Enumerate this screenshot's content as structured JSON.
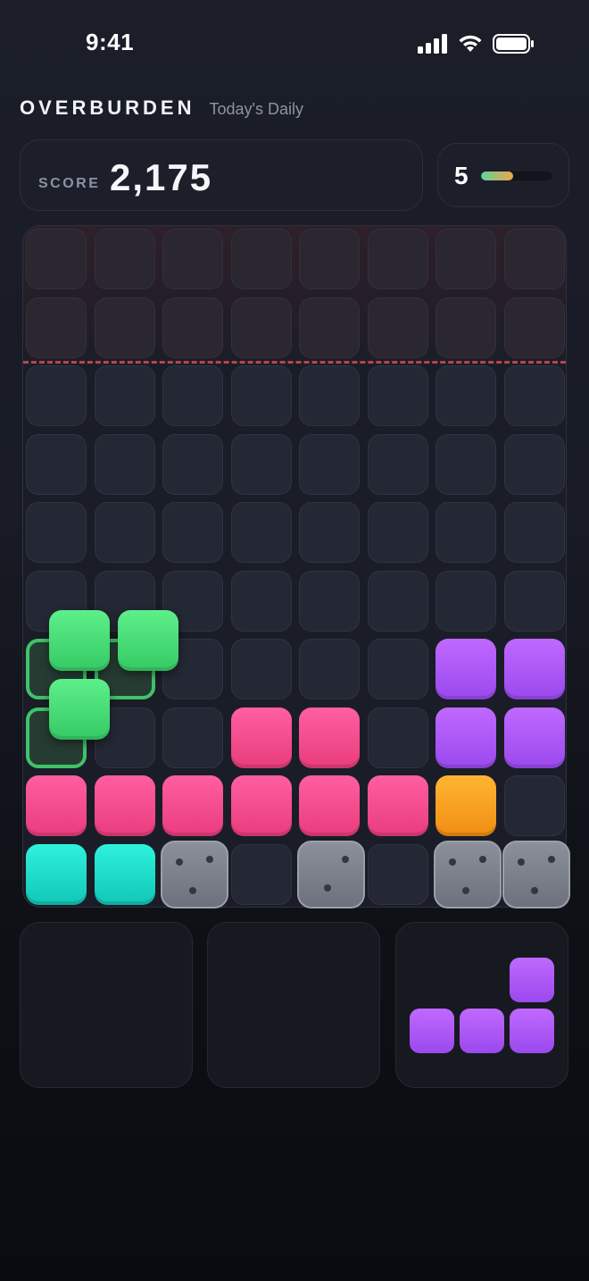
{
  "status_bar": {
    "time": "9:41",
    "icons": [
      "cellular-signal-icon",
      "wifi-icon",
      "battery-icon"
    ]
  },
  "header": {
    "title": "OVERBURDEN",
    "subtitle": "Today's Daily"
  },
  "score": {
    "label": "SCORE",
    "value": "2,175"
  },
  "level": {
    "value": "5",
    "progress": 0.45
  },
  "colors": {
    "pink": "#f04a8a",
    "purple": "#ad57f8",
    "orange": "#f7a020",
    "cyan": "#1ddccb",
    "green": "#4ee07a",
    "stone": "#7c818c",
    "danger": "#b5474e"
  },
  "board": {
    "columns": 8,
    "rows": 10,
    "danger_rows": 2,
    "grid": [
      [
        ".",
        ".",
        ".",
        ".",
        ".",
        ".",
        ".",
        "."
      ],
      [
        ".",
        ".",
        ".",
        ".",
        ".",
        ".",
        ".",
        "."
      ],
      [
        ".",
        ".",
        ".",
        ".",
        ".",
        ".",
        ".",
        "."
      ],
      [
        ".",
        ".",
        ".",
        ".",
        ".",
        ".",
        ".",
        "."
      ],
      [
        ".",
        ".",
        ".",
        ".",
        ".",
        ".",
        ".",
        "."
      ],
      [
        ".",
        ".",
        ".",
        ".",
        ".",
        ".",
        ".",
        "."
      ],
      [
        ".",
        ".",
        ".",
        ".",
        ".",
        ".",
        "purple",
        "purple"
      ],
      [
        ".",
        ".",
        ".",
        "pink",
        "pink",
        ".",
        "purple",
        "purple"
      ],
      [
        "pink",
        "pink",
        "pink",
        "pink",
        "pink",
        "pink",
        "orange",
        "."
      ],
      [
        "cyan",
        "cyan",
        "stone",
        ".",
        "stone",
        ".",
        "stone",
        "stone"
      ]
    ],
    "stone_dots": [
      3,
      2,
      3,
      3
    ],
    "ghost_cells": [
      [
        6,
        0
      ],
      [
        6,
        1
      ],
      [
        7,
        0
      ]
    ],
    "active_piece": {
      "color": "green",
      "cells": [
        [
          0,
          0
        ],
        [
          0,
          1
        ],
        [
          1,
          0
        ]
      ]
    }
  },
  "tray": [
    {
      "slot": 1,
      "piece": null
    },
    {
      "slot": 2,
      "piece": null
    },
    {
      "slot": 3,
      "piece": {
        "color": "purple",
        "cells": [
          [
            0,
            2
          ],
          [
            1,
            0
          ],
          [
            1,
            1
          ],
          [
            1,
            2
          ]
        ]
      }
    }
  ]
}
